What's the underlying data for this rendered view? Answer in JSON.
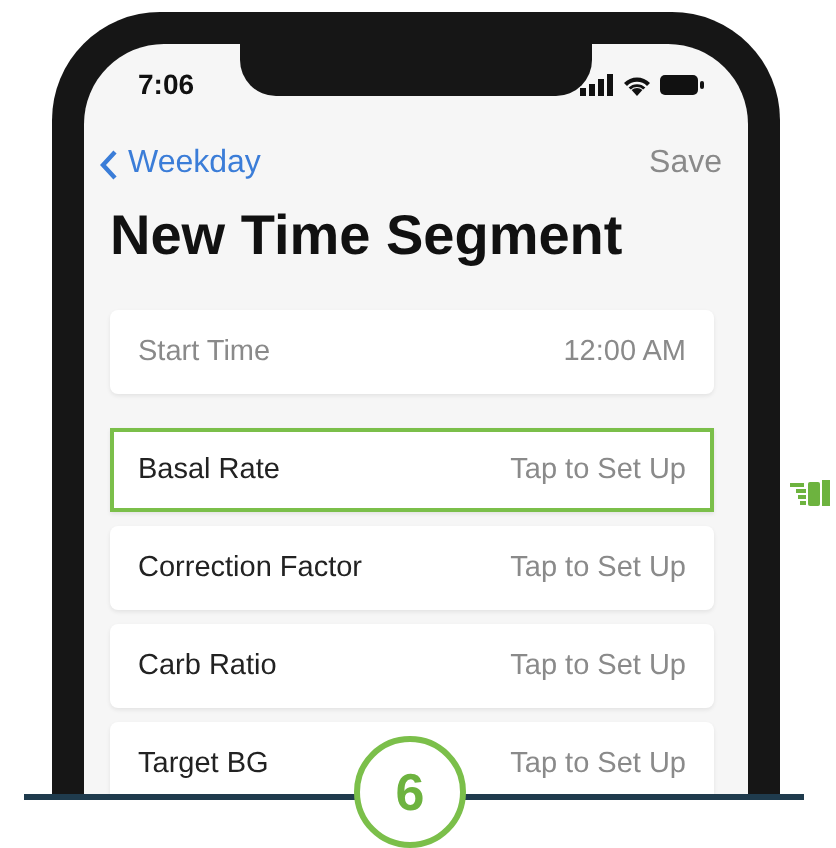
{
  "status_bar": {
    "time": "7:06"
  },
  "nav": {
    "back_label": "Weekday",
    "action": "Save"
  },
  "title": "New Time Segment",
  "groups": [
    [
      {
        "label": "Start Time",
        "value": "12:00 AM",
        "kind": "readonly",
        "selected": false
      }
    ],
    [
      {
        "label": "Basal Rate",
        "value": "Tap to Set Up",
        "kind": "setting",
        "selected": true
      },
      {
        "label": "Correction Factor",
        "value": "Tap to Set Up",
        "kind": "setting",
        "selected": false
      },
      {
        "label": "Carb Ratio",
        "value": "Tap to Set Up",
        "kind": "setting",
        "selected": false
      },
      {
        "label": "Target BG",
        "value": "Tap to Set Up",
        "kind": "setting",
        "selected": false
      }
    ]
  ],
  "step": "6"
}
